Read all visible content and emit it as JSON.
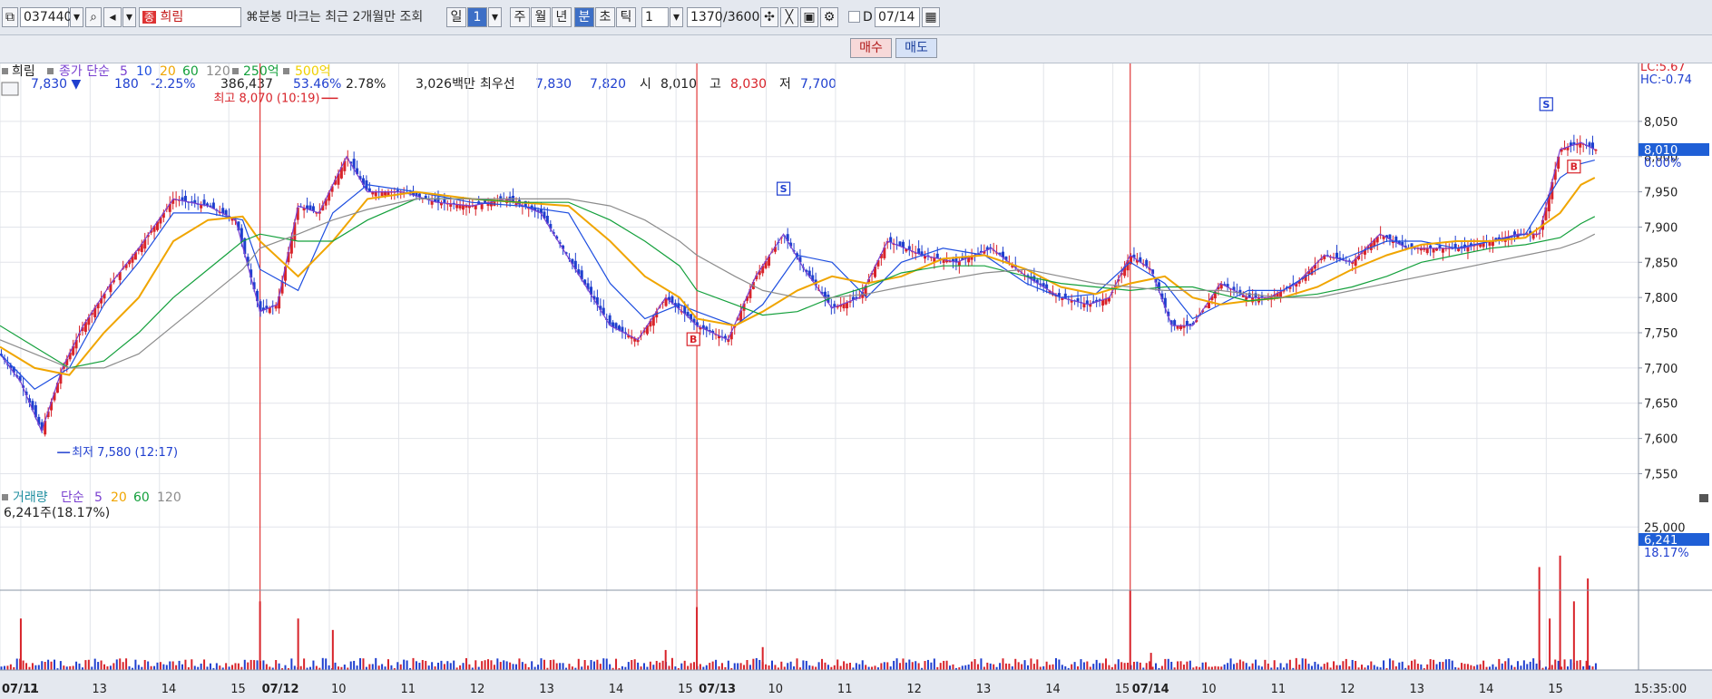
{
  "toolbar": {
    "code": "037440",
    "badge": "종",
    "name": "희림",
    "notice": "분봉 마크는 최근 2개월만 조회",
    "period_buttons": [
      "일",
      "1",
      "주",
      "월",
      "년",
      "분",
      "초",
      "틱"
    ],
    "interval": "1",
    "count": "1370",
    "count_total": "/3600",
    "date": "07/14"
  },
  "quote": {
    "price": "7,830",
    "change": "180",
    "change_pct": "-2.25%",
    "volume": "386,437",
    "ratio": "53.46%",
    "turnover_pct": "2.78%",
    "amount": "3,026백만",
    "best_label": "최우선",
    "ask": "7,830",
    "bid": "7,820",
    "open_label": "시",
    "open": "8,010",
    "high_label": "고",
    "high": "8,030",
    "low_label": "저",
    "low": "7,700",
    "buy": "매수",
    "sell": "매도"
  },
  "price_legend": {
    "name": "희림",
    "text": "종가 단순",
    "periods": [
      "5",
      "10",
      "20",
      "60",
      "120"
    ],
    "extra": [
      "250억",
      "500억"
    ]
  },
  "volume_legend": {
    "name": "거래량",
    "text": "단순",
    "periods": [
      "5",
      "20",
      "60",
      "120"
    ],
    "current": "6,241주(18.17%)"
  },
  "indicators": {
    "lc": "LC:5.67",
    "hc": "HC:-0.74"
  },
  "price_tag": {
    "value": "8,010",
    "pct": "0.00%"
  },
  "volume_tag": {
    "value": "6,241",
    "pct": "18.17%"
  },
  "annotations": {
    "high": "최고 8,070 (10:19)",
    "low": "최저 7,580 (12:17)"
  },
  "colors": {
    "up": "#d8232a",
    "down": "#1f3fcf",
    "ma5": "#7a40d0",
    "ma10": "#1f4fe0",
    "ma20": "#f0a500",
    "ma60": "#14a03c",
    "ma120": "#8c8c8c"
  },
  "chart_data": {
    "type": "line",
    "ylim": [
      7530,
      8100
    ],
    "y_ticks": [
      "8,050",
      "8,000",
      "7,950",
      "7,900",
      "7,850",
      "7,800",
      "7,750",
      "7,700",
      "7,650",
      "7,600",
      "7,550"
    ],
    "y_tick_values": [
      8050,
      8000,
      7950,
      7900,
      7850,
      7800,
      7750,
      7700,
      7650,
      7600,
      7550
    ],
    "x_labels": [
      "07/11",
      "12",
      "13",
      "14",
      "15",
      "07/12",
      "10",
      "11",
      "12",
      "13",
      "14",
      "15",
      "07/13",
      "10",
      "11",
      "12",
      "13",
      "14",
      "15",
      "07/14",
      "10",
      "11",
      "12",
      "13",
      "14",
      "15"
    ],
    "x_label_pos": [
      0,
      0.3,
      1.3,
      2.3,
      3.3,
      3.75,
      4.75,
      5.75,
      6.75,
      7.75,
      8.75,
      9.75,
      10.05,
      11.05,
      12.05,
      13.05,
      14.05,
      15.05,
      16.05,
      16.3,
      17.3,
      18.3,
      19.3,
      20.3,
      21.3,
      22.3
    ],
    "x_domain": [
      0,
      23.5
    ],
    "day_separators": [
      3.75,
      10.05,
      16.3
    ],
    "series": [
      {
        "name": "5",
        "x": [
          0,
          0.3,
          0.6,
          0.9,
          1.2,
          1.6,
          2.0,
          2.5,
          3.0,
          3.4,
          3.75,
          4.0,
          4.3,
          4.6,
          5.0,
          5.3,
          5.8,
          6.3,
          6.8,
          7.3,
          7.8,
          8.3,
          8.8,
          9.2,
          9.6,
          9.9,
          10.05,
          10.5,
          10.9,
          11.3,
          11.6,
          12.0,
          12.4,
          12.8,
          13.3,
          13.8,
          14.3,
          14.8,
          15.3,
          15.7,
          16.0,
          16.3,
          16.6,
          16.9,
          17.2,
          17.6,
          18.0,
          18.3,
          18.7,
          19.1,
          19.5,
          19.9,
          20.3,
          20.7,
          21.1,
          21.5,
          21.9,
          22.2,
          22.5,
          22.8,
          23.0
        ],
        "y": [
          7720,
          7680,
          7610,
          7700,
          7760,
          7820,
          7870,
          7940,
          7930,
          7910,
          7780,
          7790,
          7930,
          7920,
          8000,
          7950,
          7950,
          7935,
          7930,
          7940,
          7920,
          7840,
          7760,
          7740,
          7800,
          7775,
          7760,
          7740,
          7830,
          7890,
          7840,
          7785,
          7800,
          7880,
          7860,
          7850,
          7870,
          7830,
          7800,
          7790,
          7800,
          7860,
          7840,
          7760,
          7760,
          7820,
          7800,
          7800,
          7820,
          7860,
          7850,
          7890,
          7870,
          7870,
          7870,
          7880,
          7890,
          7890,
          8010,
          8020,
          8010
        ]
      },
      {
        "name": "10",
        "x": [
          0,
          0.5,
          1.0,
          1.5,
          2.0,
          2.5,
          3.0,
          3.5,
          3.75,
          4.3,
          4.8,
          5.3,
          6.0,
          6.8,
          7.5,
          8.2,
          8.8,
          9.3,
          9.8,
          10.05,
          10.6,
          11.0,
          11.5,
          12.0,
          12.5,
          13.0,
          13.6,
          14.2,
          14.8,
          15.3,
          15.8,
          16.3,
          16.8,
          17.2,
          17.6,
          18.0,
          18.5,
          19.0,
          19.5,
          20.0,
          20.5,
          21.0,
          21.5,
          22.0,
          22.5,
          22.8,
          23.0
        ],
        "y": [
          7720,
          7670,
          7700,
          7790,
          7850,
          7920,
          7920,
          7910,
          7840,
          7810,
          7920,
          7960,
          7950,
          7935,
          7930,
          7920,
          7820,
          7770,
          7790,
          7780,
          7760,
          7790,
          7860,
          7850,
          7800,
          7850,
          7870,
          7860,
          7820,
          7800,
          7805,
          7850,
          7820,
          7770,
          7790,
          7810,
          7810,
          7840,
          7860,
          7880,
          7880,
          7870,
          7880,
          7890,
          7970,
          7990,
          7995
        ]
      },
      {
        "name": "20",
        "x": [
          0,
          0.5,
          1.0,
          1.5,
          2.0,
          2.5,
          3.0,
          3.5,
          3.75,
          4.3,
          4.8,
          5.3,
          6.0,
          6.8,
          7.5,
          8.2,
          8.8,
          9.3,
          9.8,
          10.05,
          10.6,
          11.0,
          11.5,
          12.0,
          12.5,
          13.0,
          13.6,
          14.2,
          14.8,
          15.3,
          15.8,
          16.3,
          16.8,
          17.2,
          17.6,
          18.0,
          18.5,
          19.0,
          19.5,
          20.0,
          20.5,
          21.0,
          21.5,
          22.0,
          22.5,
          22.8,
          23.0
        ],
        "y": [
          7730,
          7700,
          7690,
          7750,
          7800,
          7880,
          7910,
          7915,
          7880,
          7830,
          7880,
          7940,
          7950,
          7940,
          7935,
          7930,
          7880,
          7830,
          7800,
          7770,
          7760,
          7780,
          7810,
          7830,
          7820,
          7830,
          7855,
          7860,
          7840,
          7815,
          7805,
          7820,
          7830,
          7800,
          7790,
          7795,
          7800,
          7815,
          7840,
          7860,
          7875,
          7880,
          7880,
          7885,
          7920,
          7960,
          7970
        ]
      },
      {
        "name": "60",
        "x": [
          0,
          0.5,
          1.0,
          1.5,
          2.0,
          2.5,
          3.0,
          3.5,
          3.75,
          4.3,
          4.8,
          5.3,
          6.0,
          6.8,
          7.5,
          8.2,
          8.8,
          9.3,
          9.8,
          10.05,
          10.6,
          11.0,
          11.5,
          12.0,
          12.5,
          13.0,
          13.6,
          14.2,
          14.8,
          15.3,
          15.8,
          16.3,
          16.8,
          17.2,
          17.6,
          18.0,
          18.5,
          19.0,
          19.5,
          20.0,
          20.5,
          21.0,
          21.5,
          22.0,
          22.5,
          22.8,
          23.0
        ],
        "y": [
          7760,
          7730,
          7700,
          7710,
          7750,
          7800,
          7840,
          7880,
          7890,
          7880,
          7880,
          7910,
          7940,
          7940,
          7935,
          7935,
          7910,
          7880,
          7845,
          7810,
          7790,
          7775,
          7780,
          7800,
          7815,
          7835,
          7845,
          7845,
          7830,
          7820,
          7815,
          7810,
          7815,
          7815,
          7805,
          7795,
          7800,
          7805,
          7815,
          7830,
          7850,
          7860,
          7870,
          7875,
          7885,
          7905,
          7915
        ]
      },
      {
        "name": "120",
        "x": [
          0,
          0.5,
          1.0,
          1.5,
          2.0,
          2.5,
          3.0,
          3.5,
          3.75,
          4.3,
          4.8,
          5.3,
          6.0,
          6.8,
          7.5,
          8.2,
          8.8,
          9.3,
          9.8,
          10.05,
          10.6,
          11.0,
          11.5,
          12.0,
          12.5,
          13.0,
          13.6,
          14.2,
          14.8,
          15.3,
          15.8,
          16.3,
          16.8,
          17.2,
          17.6,
          18.0,
          18.5,
          19.0,
          19.5,
          20.0,
          20.5,
          21.0,
          21.5,
          22.0,
          22.5,
          22.8,
          23.0
        ],
        "y": [
          7740,
          7720,
          7700,
          7700,
          7720,
          7760,
          7800,
          7840,
          7870,
          7890,
          7910,
          7925,
          7940,
          7940,
          7940,
          7940,
          7930,
          7910,
          7880,
          7860,
          7830,
          7810,
          7800,
          7800,
          7805,
          7815,
          7825,
          7835,
          7840,
          7830,
          7820,
          7815,
          7810,
          7810,
          7810,
          7805,
          7800,
          7800,
          7810,
          7820,
          7830,
          7840,
          7850,
          7860,
          7870,
          7880,
          7890
        ]
      }
    ],
    "volume_ylim": [
      0,
      26000
    ],
    "volume_ticks": [
      "25,000"
    ],
    "volume_tick_values": [
      25000
    ],
    "volume_bars": [
      {
        "x": 0.3,
        "v": 9000
      },
      {
        "x": 3.75,
        "v": 12000
      },
      {
        "x": 4.3,
        "v": 9000
      },
      {
        "x": 4.8,
        "v": 7000
      },
      {
        "x": 9.6,
        "v": 3500
      },
      {
        "x": 10.05,
        "v": 11000
      },
      {
        "x": 11.0,
        "v": 4000
      },
      {
        "x": 16.3,
        "v": 14000
      },
      {
        "x": 16.6,
        "v": 3000
      },
      {
        "x": 22.2,
        "v": 18000
      },
      {
        "x": 22.35,
        "v": 9000
      },
      {
        "x": 22.5,
        "v": 20000
      },
      {
        "x": 22.7,
        "v": 12000
      },
      {
        "x": 22.9,
        "v": 16000
      }
    ],
    "signals": [
      {
        "label": "S",
        "x": 11.3,
        "y": 7930,
        "kind": "sell"
      },
      {
        "label": "B",
        "x": 10.0,
        "y": 7755,
        "kind": "buy"
      },
      {
        "label": "S",
        "x": 22.3,
        "y": 8050,
        "kind": "sell"
      },
      {
        "label": "B",
        "x": 22.7,
        "y": 8000,
        "kind": "buy"
      }
    ],
    "high_point": {
      "x": 4.9,
      "y": 8070
    },
    "low_point": {
      "x": 0.8,
      "y": 7580
    },
    "volume_current": 6241,
    "last_price": 8010
  }
}
